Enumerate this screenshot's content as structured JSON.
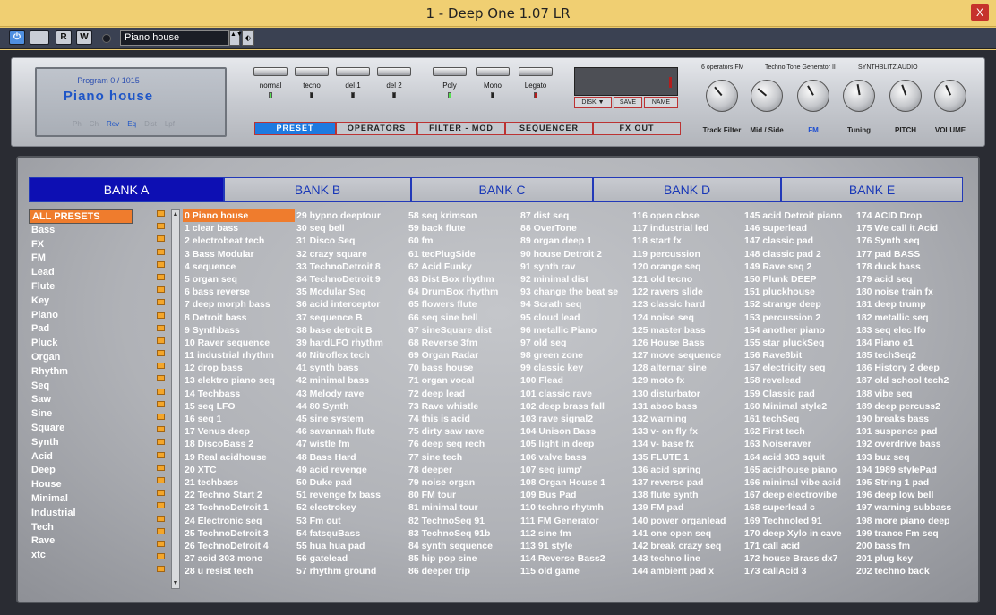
{
  "window": {
    "title": "1 - Deep One 1.07 LR",
    "close_label": "X"
  },
  "host_toolbar": {
    "power_label": "⏻",
    "buttons": [
      "",
      "R",
      "W"
    ],
    "preset_name": "Piano house",
    "spin_label": "▲▼",
    "menu_label": "⬖"
  },
  "lcd": {
    "program_line": "Program  0  /  1015",
    "program_name": "Piano  house",
    "flags": [
      {
        "label": "Ph",
        "on": false
      },
      {
        "label": "Ch",
        "on": false
      },
      {
        "label": "Rev",
        "on": true
      },
      {
        "label": "Eq",
        "on": true
      },
      {
        "label": "Dist",
        "on": false
      },
      {
        "label": "Lpf",
        "on": false
      }
    ]
  },
  "modes": [
    {
      "label": "normal",
      "led": "green"
    },
    {
      "label": "tecno",
      "led": "off"
    },
    {
      "label": "del 1",
      "led": "off"
    },
    {
      "label": "del 2",
      "led": "off"
    },
    {
      "label": "Poly",
      "led": "green"
    },
    {
      "label": "Mono",
      "led": "off"
    },
    {
      "label": "Legato",
      "led": "red"
    }
  ],
  "disk_buttons": [
    "DISK ▼",
    "SAVE",
    "NAME"
  ],
  "section_tabs": [
    "PRESET",
    "OPERATORS",
    "FILTER - MOD",
    "SEQUENCER",
    "FX OUT"
  ],
  "section_active": "PRESET",
  "synth_info": [
    "6  operators  FM",
    "Techno  Tone  Generator  II",
    "SYNTHBLITZ  AUDIO"
  ],
  "knobs": [
    {
      "label": "Track Filter",
      "angle_deg": -40
    },
    {
      "label": "Mid / Side",
      "angle_deg": -50
    },
    {
      "label": "FM",
      "angle_deg": -30
    },
    {
      "label": "Tuning",
      "angle_deg": -10
    },
    {
      "label": "PITCH",
      "angle_deg": -20
    },
    {
      "label": "VOLUME",
      "angle_deg": -25
    }
  ],
  "banks": [
    "BANK A",
    "BANK B",
    "BANK C",
    "BANK D",
    "BANK E"
  ],
  "bank_active": "BANK A",
  "categories": [
    "ALL PRESETS",
    "Bass",
    "FX",
    "FM",
    "Lead",
    "Flute",
    "Key",
    "Piano",
    "Pad",
    "Pluck",
    "Organ",
    "Rhythm",
    "Seq",
    "Saw",
    "Sine",
    "Square",
    "Synth",
    "Acid",
    "Deep",
    "House",
    "Minimal",
    "Industrial",
    "Tech",
    "Rave",
    "xtc"
  ],
  "category_active": "ALL PRESETS",
  "scroll": {
    "up": "▲",
    "down": "▼"
  },
  "presets": [
    [
      "0 Piano house",
      "1 clear bass",
      "2 electrobeat tech",
      "3 Bass Modular",
      "4 sequence",
      "5 organ seq",
      "6 bass reverse",
      "7 deep morph bass",
      "8 Detroit bass",
      "9 Synthbass",
      "10 Raver sequence",
      "11 industrial rhythm",
      "12 drop bass",
      "13 elektro piano seq",
      "14 Techbass",
      "15 seq LFO",
      "16 seq 1",
      "17 Venus deep",
      "18 DiscoBass 2",
      "19 Real acidhouse",
      "20 XTC",
      "21 techbass",
      "22 Techno Start 2",
      "23 TechnoDetroit 1",
      "24 Electronic seq",
      "25 TechnoDetroit 3",
      "26 TechnoDetroit 4",
      "27 acid 303 mono",
      "28 u resist tech"
    ],
    [
      "29 hypno deeptour",
      "30 seq bell",
      "31 Disco Seq",
      "32 crazy square",
      "33 TechnoDetroit 8",
      "34 TechnoDetroit 9",
      "35 Modular Seq",
      "36 acid interceptor",
      "37 sequence B",
      "38 base detroit B",
      "39 hardLFO rhythm",
      "40 Nitroflex tech",
      "41 synth bass",
      "42 minimal bass",
      "43 Melody rave",
      "44 80 Synth",
      "45 sine system",
      "46 savannah flute",
      "47 wistle fm",
      "48 Bass Hard",
      "49 acid revenge",
      "50 Duke pad",
      "51 revenge fx bass",
      "52 electrokey",
      "53 Fm out",
      "54 fatsquBass",
      "55 hua hua pad",
      "56 gatelead",
      "57 rhythm ground"
    ],
    [
      "58 seq krimson",
      "59 back flute",
      "60 fm",
      "61 tecPlugSide",
      "62 Acid Funky",
      "63 Dist Box rhythm",
      "64 DrumBox rhythm",
      "65 flowers flute",
      "66 seq sine bell",
      "67 sineSquare dist",
      "68 Reverse 3fm",
      "69 Organ Radar",
      "70 bass house",
      "71 organ vocal",
      "72 deep lead",
      "73 Rave whistle",
      "74 this is acid",
      "75 dirty saw rave",
      "76 deep seq rech",
      "77 sine tech",
      "78 deeper",
      "79 noise organ",
      "80 FM tour",
      "81 minimal tour",
      "82 TechnoSeq 91",
      "83 TechnoSeq 91b",
      "84 synth sequence",
      "85 hip pop sine",
      "86 deeper trip"
    ],
    [
      "87 dist seq",
      "88 OverTone",
      "89 organ deep 1",
      "90 house Detroit 2",
      "91 synth rav",
      "92 minimal dist",
      "93 change the beat se",
      "94 Scrath seq",
      "95 cloud lead",
      "96 metallic Piano",
      "97 old seq",
      "98 green zone",
      "99 classic key",
      "100 Flead",
      "101 classic rave",
      "102 deep brass fall",
      "103 rave signal2",
      "104 Unison Bass",
      "105 light in deep",
      "106 valve bass",
      "107 seq jump'",
      "108 Organ House 1",
      "109 Bus Pad",
      "110 techno rhytmh",
      "111 FM Generator",
      "112 sine fm",
      "113 91 style",
      "114 Reverse Bass2",
      "115 old game"
    ],
    [
      "116 open close",
      "117 industrial led",
      "118 start fx",
      "119 percussion",
      "120 orange seq",
      "121 old tecno",
      "122 ravers slide",
      "123 classic hard",
      "124 noise seq",
      "125 master bass",
      "126 House Bass",
      "127 move sequence",
      "128 alternar sine",
      "129 moto fx",
      "130 disturbator",
      "131 aboo bass",
      "132 warning",
      "133 v- on fly fx",
      "134 v- base fx",
      "135 FLUTE 1",
      "136 acid spring",
      "137 reverse pad",
      "138 flute synth",
      "139 FM pad",
      "140 power organlead",
      "141 one open seq",
      "142 break crazy seq",
      "143 techno line",
      "144 ambient pad x"
    ],
    [
      "145 acid Detroit piano",
      "146 superlead",
      "147 classic pad",
      "148 classic pad 2",
      "149 Rave seq 2",
      "150 Plunk DEEP",
      "151 pluckhouse",
      "152 strange deep",
      "153 percussion 2",
      "154 another piano",
      "155 star pluckSeq",
      "156 Rave8bit",
      "157 electricity seq",
      "158 revelead",
      "159 Classic pad",
      "160 Minimal style2",
      "161 techSeq",
      "162 First tech",
      "163 Noiseraver",
      "164 acid 303 squit",
      "165 acidhouse piano",
      "166 minimal vibe acid",
      "167 deep electrovibe",
      "168 superlead c",
      "169 Technoled 91",
      "170 deep Xylo in cave",
      "171 call acid",
      "172 house Brass dx7",
      "173 callAcid 3"
    ],
    [
      "174 ACID Drop",
      "175 We call it Acid",
      "176 Synth seq",
      "177 pad BASS",
      "178 duck bass",
      "179 acid seq",
      "180 noise train fx",
      "181 deep trump",
      "182 metallic seq",
      "183 seq elec lfo",
      "184 Piano e1",
      "185 techSeq2",
      "186 History 2 deep",
      "187 old school tech2",
      "188 vibe seq",
      "189 deep percuss2",
      "190 breaks bass",
      "191 suspence pad",
      "192 overdrive bass",
      "193 buz seq",
      "194 1989 stylePad",
      "195 String 1 pad",
      "196 deep low bell",
      "197 warning subbass",
      "198 more piano deep",
      "199 trance Fm seq",
      "200 bass fm",
      "201 plug key",
      "202 techno back"
    ]
  ],
  "preset_active": "0 Piano house",
  "colors": {
    "accent_orange": "#ef7c2d",
    "bank_blue": "#0d0fb3",
    "preset_blue": "#1e7ae0",
    "title_bar": "#f0cf72"
  }
}
